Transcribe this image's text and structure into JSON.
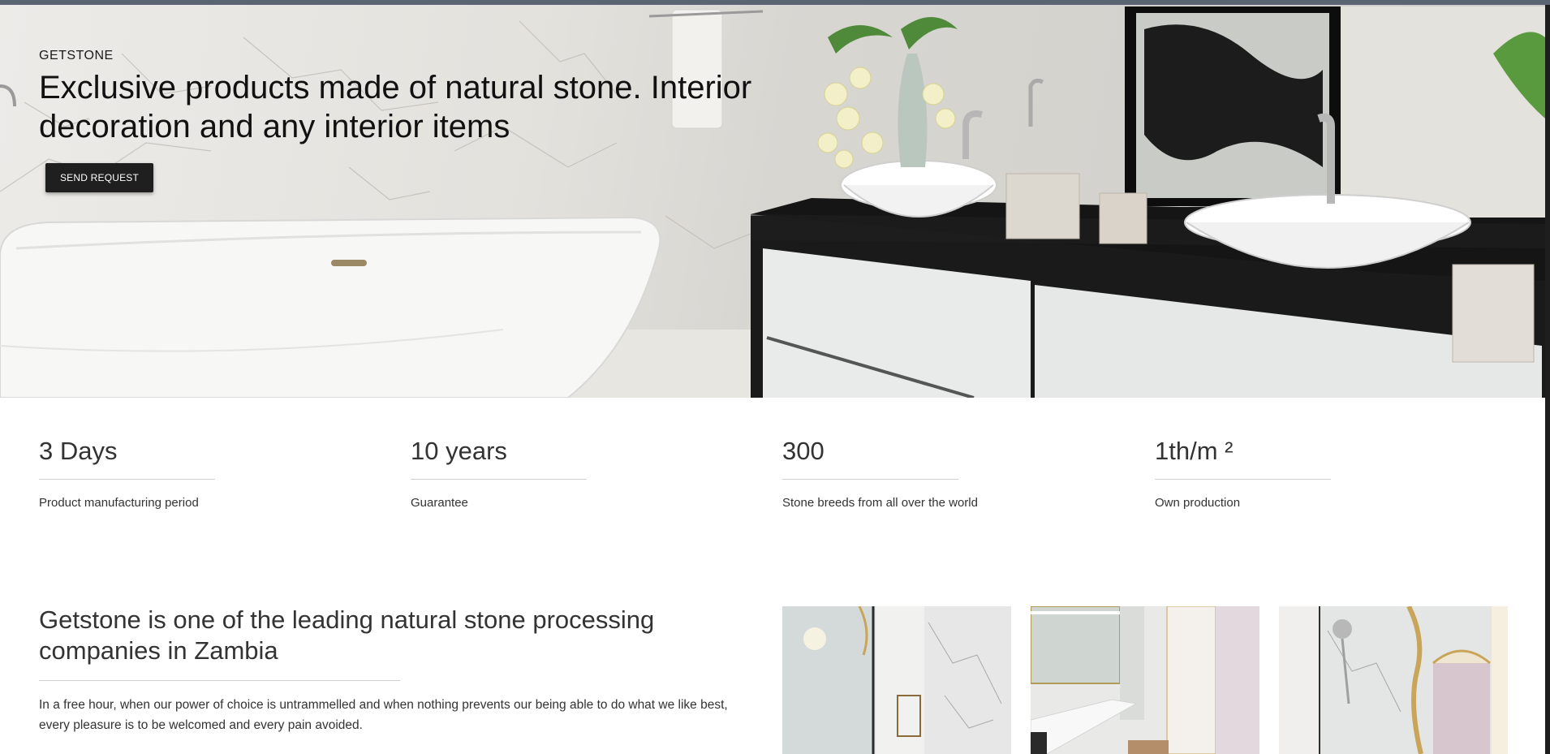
{
  "hero": {
    "brand": "GETSTONE",
    "headline": "Exclusive products made of natural stone. Interior decoration and any interior items",
    "cta_label": "SEND REQUEST"
  },
  "stats": [
    {
      "value": "3 Days",
      "label": "Product manufacturing period"
    },
    {
      "value": "10 years",
      "label": "Guarantee"
    },
    {
      "value": "300",
      "label": "Stone breeds from all over the world"
    },
    {
      "value": "1th/m ²",
      "label": "Own production"
    }
  ],
  "about": {
    "title": "Getstone is one of the leading natural stone processing companies in Zambia",
    "text": "In a free hour, when our power of choice is untrammelled and when nothing prevents our being able to do what we like best, every pleasure is to be welcomed and every pain avoided."
  },
  "gallery": {
    "items": [
      {
        "icon": "bathroom-shower-photo"
      },
      {
        "icon": "bathroom-vanity-photo"
      },
      {
        "icon": "bathroom-shower-gold-photo"
      }
    ]
  },
  "colors": {
    "button_bg": "#1f1f1f",
    "text_dark": "#111111",
    "rule": "#cfcfcf"
  }
}
